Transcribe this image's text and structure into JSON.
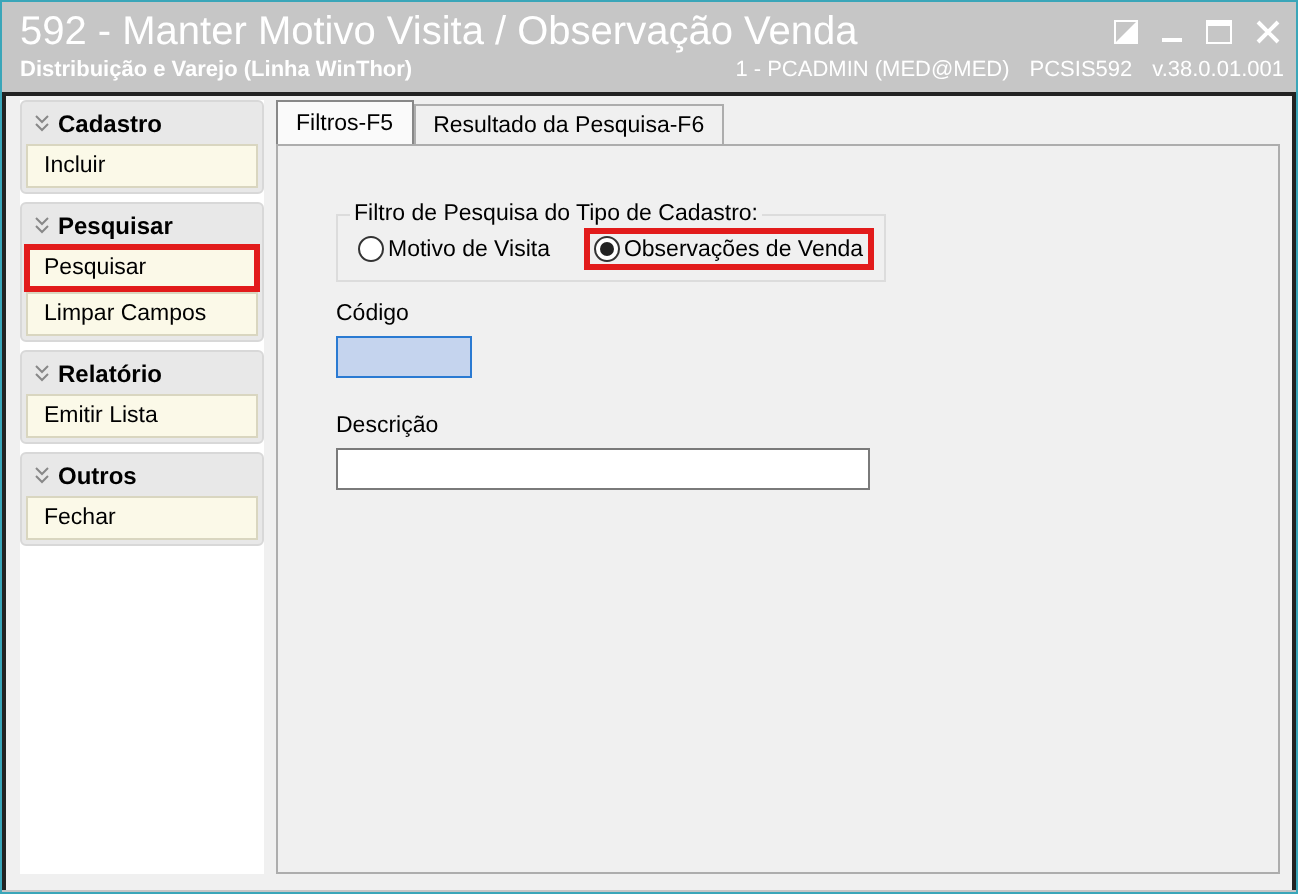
{
  "window": {
    "title": "592 - Manter Motivo Visita / Observação Venda",
    "subtitle": "Distribuição e Varejo (Linha WinThor)",
    "user": "1 - PCADMIN (MED@MED)",
    "program": "PCSIS592",
    "version": "v.38.0.01.001"
  },
  "sidebar": {
    "groups": [
      {
        "title": "Cadastro",
        "items": [
          {
            "label": "Incluir",
            "highlighted": false
          }
        ]
      },
      {
        "title": "Pesquisar",
        "items": [
          {
            "label": "Pesquisar",
            "highlighted": true
          },
          {
            "label": "Limpar Campos",
            "highlighted": false
          }
        ]
      },
      {
        "title": "Relatório",
        "items": [
          {
            "label": "Emitir Lista",
            "highlighted": false
          }
        ]
      },
      {
        "title": "Outros",
        "items": [
          {
            "label": "Fechar",
            "highlighted": false
          }
        ]
      }
    ]
  },
  "tabs": [
    {
      "label": "Filtros-F5",
      "selected": true
    },
    {
      "label": "Resultado da Pesquisa-F6",
      "selected": false
    }
  ],
  "filter": {
    "title": "Filtro de Pesquisa do Tipo de Cadastro:",
    "options": [
      {
        "label": "Motivo de Visita",
        "selected": false,
        "highlighted": false
      },
      {
        "label": "Observações de Venda",
        "selected": true,
        "highlighted": true
      }
    ]
  },
  "fields": [
    {
      "label": "Código",
      "focused": true
    },
    {
      "label": "Descrição",
      "focused": false
    }
  ]
}
